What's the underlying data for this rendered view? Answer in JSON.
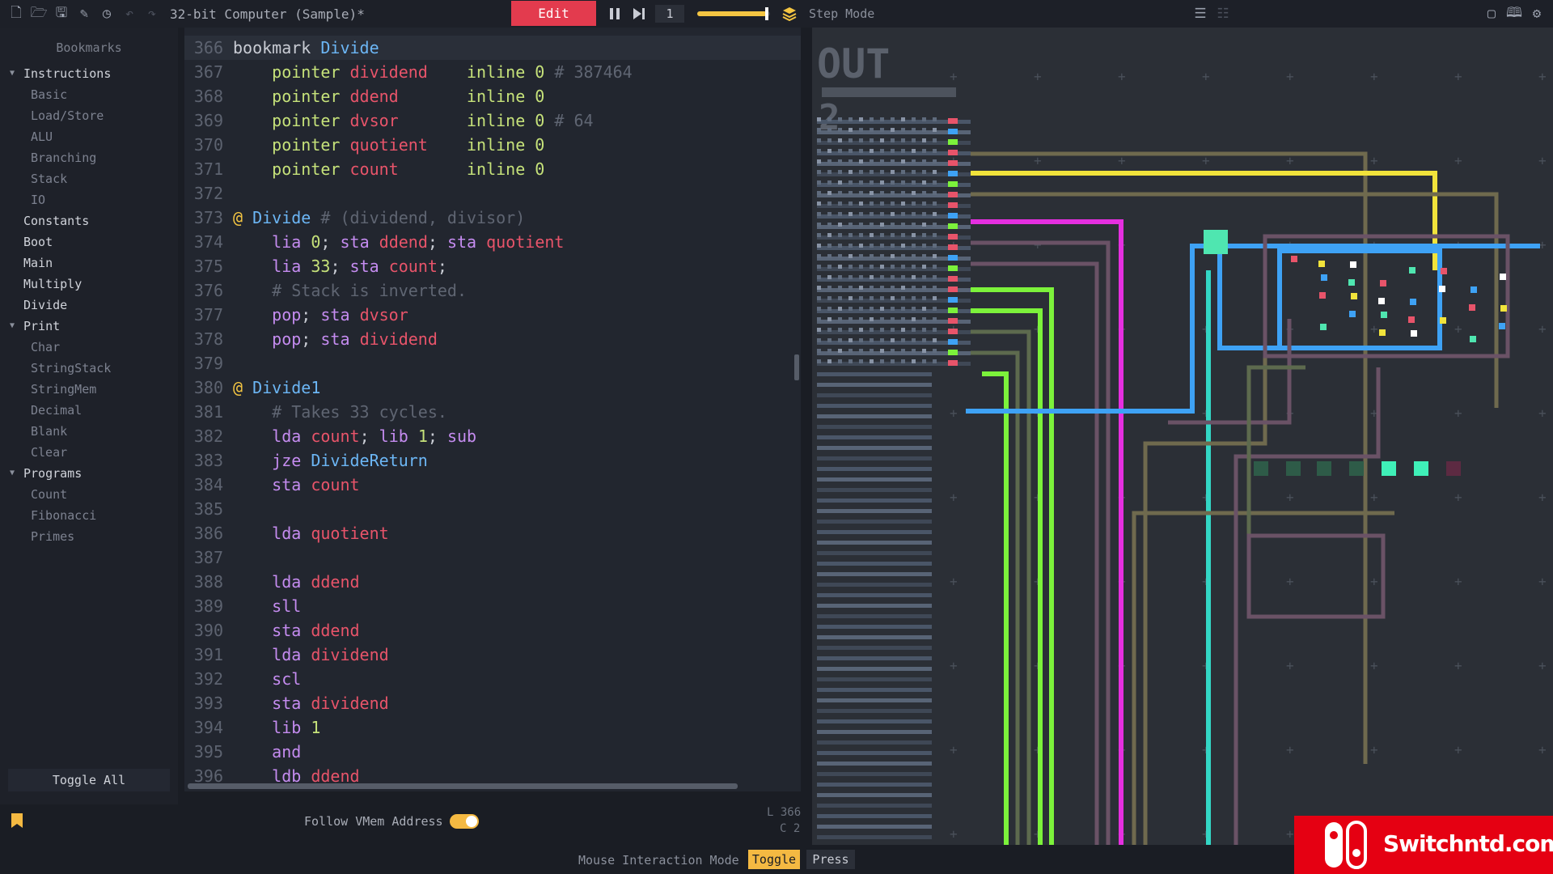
{
  "toolbar": {
    "title": "32-bit Computer (Sample)*",
    "edit_label": "Edit",
    "step_count": "1",
    "speed_level": 0.95,
    "step_mode_label": "Step Mode",
    "accent_color": "#e33b4e",
    "highlight_color": "#f4c542"
  },
  "sidebar": {
    "header": "Bookmarks",
    "items": [
      {
        "label": "Instructions",
        "level": 0,
        "expanded": true
      },
      {
        "label": "Basic",
        "level": 1
      },
      {
        "label": "Load/Store",
        "level": 1
      },
      {
        "label": "ALU",
        "level": 1
      },
      {
        "label": "Branching",
        "level": 1
      },
      {
        "label": "Stack",
        "level": 1
      },
      {
        "label": "IO",
        "level": 1
      },
      {
        "label": "Constants",
        "level": 0
      },
      {
        "label": "Boot",
        "level": 0
      },
      {
        "label": "Main",
        "level": 0
      },
      {
        "label": "Multiply",
        "level": 0
      },
      {
        "label": "Divide",
        "level": 0
      },
      {
        "label": "Print",
        "level": 0,
        "expanded": true
      },
      {
        "label": "Char",
        "level": 1
      },
      {
        "label": "StringStack",
        "level": 1
      },
      {
        "label": "StringMem",
        "level": 1
      },
      {
        "label": "Decimal",
        "level": 1
      },
      {
        "label": "Blank",
        "level": 1
      },
      {
        "label": "Clear",
        "level": 1
      },
      {
        "label": "Programs",
        "level": 0,
        "expanded": true
      },
      {
        "label": "Count",
        "level": 1
      },
      {
        "label": "Fibonacci",
        "level": 1
      },
      {
        "label": "Primes",
        "level": 1
      }
    ],
    "toggle_all": "Toggle All"
  },
  "editor": {
    "active_line": 366,
    "lines": [
      {
        "n": "366",
        "t": [
          [
            "txt",
            "bookmark "
          ],
          [
            "lab",
            "Divide"
          ]
        ]
      },
      {
        "n": "367",
        "t": [
          [
            "txt",
            "    "
          ],
          [
            "num",
            "pointer "
          ],
          [
            "var",
            "dividend    "
          ],
          [
            "num",
            "inline 0 "
          ],
          [
            "cm",
            "# 387464"
          ]
        ]
      },
      {
        "n": "368",
        "t": [
          [
            "txt",
            "    "
          ],
          [
            "num",
            "pointer "
          ],
          [
            "var",
            "ddend       "
          ],
          [
            "num",
            "inline 0"
          ]
        ]
      },
      {
        "n": "369",
        "t": [
          [
            "txt",
            "    "
          ],
          [
            "num",
            "pointer "
          ],
          [
            "var",
            "dvsor       "
          ],
          [
            "num",
            "inline 0 "
          ],
          [
            "cm",
            "# 64"
          ]
        ]
      },
      {
        "n": "370",
        "t": [
          [
            "txt",
            "    "
          ],
          [
            "num",
            "pointer "
          ],
          [
            "var",
            "quotient    "
          ],
          [
            "num",
            "inline 0"
          ]
        ]
      },
      {
        "n": "371",
        "t": [
          [
            "txt",
            "    "
          ],
          [
            "num",
            "pointer "
          ],
          [
            "var",
            "count       "
          ],
          [
            "num",
            "inline 0"
          ]
        ]
      },
      {
        "n": "372",
        "t": []
      },
      {
        "n": "373",
        "t": [
          [
            "at",
            "@ "
          ],
          [
            "lab",
            "Divide "
          ],
          [
            "cm",
            "# (dividend, divisor)"
          ]
        ]
      },
      {
        "n": "374",
        "t": [
          [
            "txt",
            "    "
          ],
          [
            "kw",
            "lia "
          ],
          [
            "num",
            "0"
          ],
          [
            "txt",
            "; "
          ],
          [
            "kw",
            "sta "
          ],
          [
            "var",
            "ddend"
          ],
          [
            "txt",
            "; "
          ],
          [
            "kw",
            "sta "
          ],
          [
            "var",
            "quotient"
          ]
        ]
      },
      {
        "n": "375",
        "t": [
          [
            "txt",
            "    "
          ],
          [
            "kw",
            "lia "
          ],
          [
            "num",
            "33"
          ],
          [
            "txt",
            "; "
          ],
          [
            "kw",
            "sta "
          ],
          [
            "var",
            "count"
          ],
          [
            "txt",
            ";"
          ]
        ]
      },
      {
        "n": "376",
        "t": [
          [
            "txt",
            "    "
          ],
          [
            "cm",
            "# Stack is inverted."
          ]
        ]
      },
      {
        "n": "377",
        "t": [
          [
            "txt",
            "    "
          ],
          [
            "kw",
            "pop"
          ],
          [
            "txt",
            "; "
          ],
          [
            "kw",
            "sta "
          ],
          [
            "var",
            "dvsor"
          ]
        ]
      },
      {
        "n": "378",
        "t": [
          [
            "txt",
            "    "
          ],
          [
            "kw",
            "pop"
          ],
          [
            "txt",
            "; "
          ],
          [
            "kw",
            "sta "
          ],
          [
            "var",
            "dividend"
          ]
        ]
      },
      {
        "n": "379",
        "t": []
      },
      {
        "n": "380",
        "t": [
          [
            "at",
            "@ "
          ],
          [
            "lab",
            "Divide1"
          ]
        ]
      },
      {
        "n": "381",
        "t": [
          [
            "txt",
            "    "
          ],
          [
            "cm",
            "# Takes 33 cycles."
          ]
        ]
      },
      {
        "n": "382",
        "t": [
          [
            "txt",
            "    "
          ],
          [
            "kw",
            "lda "
          ],
          [
            "var",
            "count"
          ],
          [
            "txt",
            "; "
          ],
          [
            "kw",
            "lib "
          ],
          [
            "num",
            "1"
          ],
          [
            "txt",
            "; "
          ],
          [
            "kw",
            "sub"
          ]
        ]
      },
      {
        "n": "383",
        "t": [
          [
            "txt",
            "    "
          ],
          [
            "kw",
            "jze "
          ],
          [
            "lab",
            "DivideReturn"
          ]
        ]
      },
      {
        "n": "384",
        "t": [
          [
            "txt",
            "    "
          ],
          [
            "kw",
            "sta "
          ],
          [
            "var",
            "count"
          ]
        ]
      },
      {
        "n": "385",
        "t": []
      },
      {
        "n": "386",
        "t": [
          [
            "txt",
            "    "
          ],
          [
            "kw",
            "lda "
          ],
          [
            "var",
            "quotient"
          ]
        ]
      },
      {
        "n": "387",
        "t": []
      },
      {
        "n": "388",
        "t": [
          [
            "txt",
            "    "
          ],
          [
            "kw",
            "lda "
          ],
          [
            "var",
            "ddend"
          ]
        ]
      },
      {
        "n": "389",
        "t": [
          [
            "txt",
            "    "
          ],
          [
            "kw",
            "sll"
          ]
        ]
      },
      {
        "n": "390",
        "t": [
          [
            "txt",
            "    "
          ],
          [
            "kw",
            "sta "
          ],
          [
            "var",
            "ddend"
          ]
        ]
      },
      {
        "n": "391",
        "t": [
          [
            "txt",
            "    "
          ],
          [
            "kw",
            "lda "
          ],
          [
            "var",
            "dividend"
          ]
        ]
      },
      {
        "n": "392",
        "t": [
          [
            "txt",
            "    "
          ],
          [
            "kw",
            "scl"
          ]
        ]
      },
      {
        "n": "393",
        "t": [
          [
            "txt",
            "    "
          ],
          [
            "kw",
            "sta "
          ],
          [
            "var",
            "dividend"
          ]
        ]
      },
      {
        "n": "394",
        "t": [
          [
            "txt",
            "    "
          ],
          [
            "kw",
            "lib "
          ],
          [
            "num",
            "1"
          ]
        ]
      },
      {
        "n": "395",
        "t": [
          [
            "txt",
            "    "
          ],
          [
            "kw",
            "and"
          ]
        ]
      },
      {
        "n": "396",
        "t": [
          [
            "txt",
            "    "
          ],
          [
            "kw",
            "ldb "
          ],
          [
            "var",
            "ddend"
          ]
        ]
      }
    ]
  },
  "status": {
    "follow_vmem_label": "Follow VMem Address",
    "follow_vmem_on": true,
    "cursor_line": "L 366",
    "cursor_col": "C 2",
    "mouse_mode_label": "Mouse Interaction Mode",
    "toggle_label": "Toggle",
    "press_label": "Press"
  },
  "circuit": {
    "out_label": "OUT",
    "out_digit": "2"
  },
  "watermark": {
    "text": "Switchntd.com"
  }
}
